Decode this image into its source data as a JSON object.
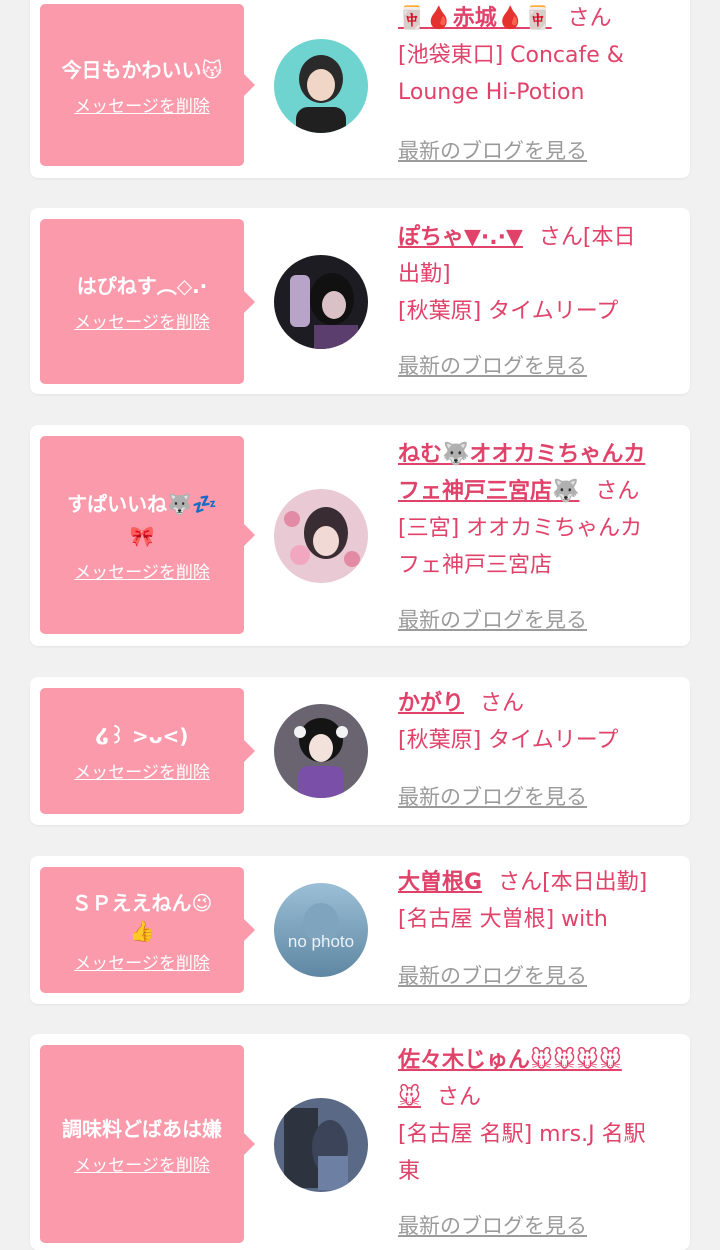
{
  "messages": [
    {
      "message": "今日もかわいい😽",
      "delete_label": "メッセージを削除",
      "name": "🀄🩸赤城🩸🀄",
      "suffix": "さん",
      "shop_lines": [
        "[池袋東口] Concafe &",
        "Lounge Hi-Potion"
      ],
      "blog_label": "最新のブログを見る",
      "avatar_colors": [
        "#6fd3cf",
        "#2a2a2a"
      ]
    },
    {
      "message": "はぴねす︵◇.·",
      "delete_label": "メッセージを削除",
      "name": "ぽちゃ▼·.·▼",
      "suffix": "さん[本日",
      "name_line2": "出勤]",
      "shop_lines": [
        "[秋葉原] タイムリープ"
      ],
      "blog_label": "最新のブログを見る",
      "avatar_colors": [
        "#1c1c22",
        "#b8a3c9"
      ]
    },
    {
      "message": "すぱいいね🐺💤",
      "message_line2": "🎀",
      "delete_label": "メッセージを削除",
      "name": "ねむ🐺オオカミちゃんカ",
      "name_line2": "フェ神戸三宮店🐺",
      "suffix": "さん",
      "shop_lines": [
        "[三宮] オオカミちゃんカ",
        "フェ神戸三宮店"
      ],
      "blog_label": "最新のブログを見る",
      "avatar_colors": [
        "#e9c9d3",
        "#3a2c33"
      ]
    },
    {
      "message": "໒꒱ >ᴗ<)",
      "delete_label": "メッセージを削除",
      "name": "かがり",
      "suffix": "さん",
      "shop_lines": [
        "[秋葉原] タイムリープ"
      ],
      "blog_label": "最新のブログを見る",
      "avatar_colors": [
        "#6a6370",
        "#7a4fa8"
      ]
    },
    {
      "message": "ＳＰええねん😉",
      "message_line2": "👍",
      "delete_label": "メッセージを削除",
      "name": "大曽根G",
      "suffix": "さん[本日出勤]",
      "shop_lines": [
        "[名古屋 大曽根] with"
      ],
      "blog_label": "最新のブログを見る",
      "avatar_colors": [
        "#9bbfd6",
        "#5f87a3"
      ],
      "avatar_text": "no photo"
    },
    {
      "message": "調味料どばあは嫌",
      "delete_label": "メッセージを削除",
      "name": "佐々木じゅん🐭🐭🐭🐭",
      "name_line2": "🐭",
      "suffix": "さん",
      "shop_lines": [
        "[名古屋 名駅] mrs.J 名駅",
        "東"
      ],
      "blog_label": "最新のブログを見る",
      "avatar_colors": [
        "#5a6a86",
        "#2e3340"
      ]
    }
  ]
}
